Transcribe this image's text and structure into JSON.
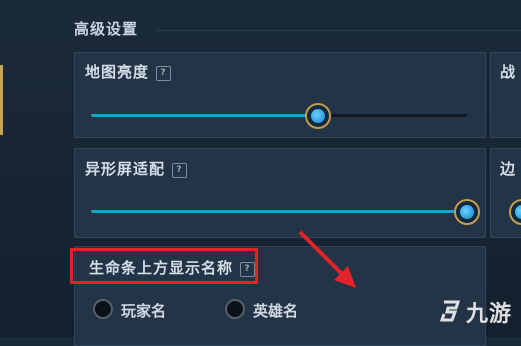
{
  "section": {
    "title": "高级设置"
  },
  "panels": {
    "map_brightness": {
      "title": "地图亮度",
      "help": "?",
      "value": 0.7
    },
    "notch_screen": {
      "title": "异形屏适配",
      "help": "?",
      "value": 1.0
    },
    "right_panel_1": {
      "title": "战"
    },
    "right_panel_2": {
      "title": "边"
    },
    "health_bar_name": {
      "title": "生命条上方显示名称",
      "help": "?",
      "options": [
        "玩家名",
        "英雄名"
      ]
    }
  },
  "watermark": {
    "text": "九游"
  },
  "colors": {
    "accent": "#1da0d4",
    "highlight": "#e3222a",
    "gold": "#c89b48"
  }
}
